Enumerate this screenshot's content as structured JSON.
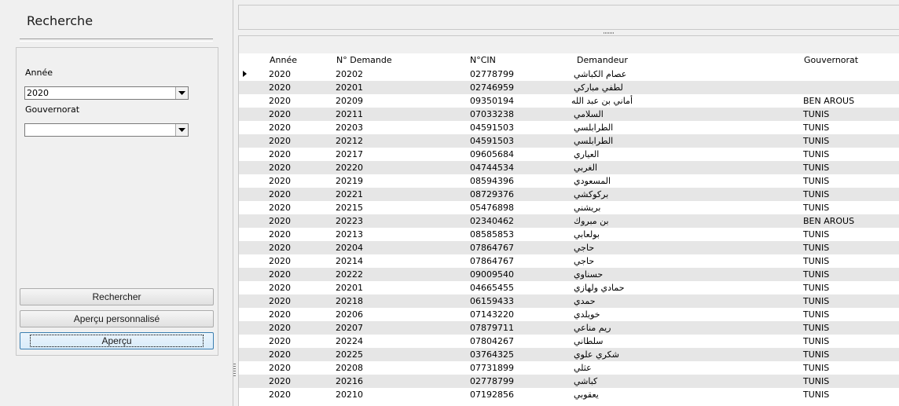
{
  "panel": {
    "title": "Recherche",
    "annee_label": "Année",
    "annee_value": "2020",
    "gouvernorat_label": "Gouvernorat",
    "gouvernorat_value": "",
    "btn_rechercher": "Rechercher",
    "btn_apercu_perso": "Aperçu personnalisé",
    "btn_apercu": "Aperçu"
  },
  "grid": {
    "columns": [
      "Année",
      "N° Demande",
      "N°CIN",
      "Demandeur",
      "Gouvernorat"
    ],
    "current_row": 0,
    "rows": [
      {
        "annee": "2020",
        "num": "20202",
        "cin": "02778799",
        "demandeur": "عصام الكباشي",
        "gouv": ""
      },
      {
        "annee": "2020",
        "num": "20201",
        "cin": "02746959",
        "demandeur": "لطفي مباركي",
        "gouv": ""
      },
      {
        "annee": "2020",
        "num": "20209",
        "cin": "09350194",
        "demandeur": "أماني بن عبد الله",
        "gouv": "BEN AROUS"
      },
      {
        "annee": "2020",
        "num": "20211",
        "cin": "07033238",
        "demandeur": "السلامي",
        "gouv": "TUNIS"
      },
      {
        "annee": "2020",
        "num": "20203",
        "cin": "04591503",
        "demandeur": "الطرابلسي",
        "gouv": "TUNIS"
      },
      {
        "annee": "2020",
        "num": "20212",
        "cin": "04591503",
        "demandeur": "الطرابلسي",
        "gouv": "TUNIS"
      },
      {
        "annee": "2020",
        "num": "20217",
        "cin": "09605684",
        "demandeur": "العياري",
        "gouv": "TUNIS"
      },
      {
        "annee": "2020",
        "num": "20220",
        "cin": "04744534",
        "demandeur": "الغربي",
        "gouv": "TUNIS"
      },
      {
        "annee": "2020",
        "num": "20219",
        "cin": "08594396",
        "demandeur": "المسعودي",
        "gouv": "TUNIS"
      },
      {
        "annee": "2020",
        "num": "20221",
        "cin": "08729376",
        "demandeur": "بركوكشي",
        "gouv": "TUNIS"
      },
      {
        "annee": "2020",
        "num": "20215",
        "cin": "05476898",
        "demandeur": "بريشني",
        "gouv": "TUNIS"
      },
      {
        "annee": "2020",
        "num": "20223",
        "cin": "02340462",
        "demandeur": "بن مبروك",
        "gouv": "BEN AROUS"
      },
      {
        "annee": "2020",
        "num": "20213",
        "cin": "08585853",
        "demandeur": "بولعابي",
        "gouv": "TUNIS"
      },
      {
        "annee": "2020",
        "num": "20204",
        "cin": "07864767",
        "demandeur": "حاجي",
        "gouv": "TUNIS"
      },
      {
        "annee": "2020",
        "num": "20214",
        "cin": "07864767",
        "demandeur": "حاجي",
        "gouv": "TUNIS"
      },
      {
        "annee": "2020",
        "num": "20222",
        "cin": "09009540",
        "demandeur": "حسناوي",
        "gouv": "TUNIS"
      },
      {
        "annee": "2020",
        "num": "20201",
        "cin": "04665455",
        "demandeur": "حمادي ولهازي",
        "gouv": "TUNIS"
      },
      {
        "annee": "2020",
        "num": "20218",
        "cin": "06159433",
        "demandeur": "حمدي",
        "gouv": "TUNIS"
      },
      {
        "annee": "2020",
        "num": "20206",
        "cin": "07143220",
        "demandeur": "خويلدي",
        "gouv": "TUNIS"
      },
      {
        "annee": "2020",
        "num": "20207",
        "cin": "07879711",
        "demandeur": "ريم مناعي",
        "gouv": "TUNIS"
      },
      {
        "annee": "2020",
        "num": "20224",
        "cin": "07804267",
        "demandeur": "سلطاني",
        "gouv": "TUNIS"
      },
      {
        "annee": "2020",
        "num": "20225",
        "cin": "03764325",
        "demandeur": "شكري علوي",
        "gouv": "TUNIS"
      },
      {
        "annee": "2020",
        "num": "20208",
        "cin": "07731899",
        "demandeur": "عثلي",
        "gouv": "TUNIS"
      },
      {
        "annee": "2020",
        "num": "20216",
        "cin": "02778799",
        "demandeur": "كباشي",
        "gouv": "TUNIS"
      },
      {
        "annee": "2020",
        "num": "20210",
        "cin": "07192856",
        "demandeur": "يعقوبي",
        "gouv": "TUNIS"
      }
    ]
  }
}
